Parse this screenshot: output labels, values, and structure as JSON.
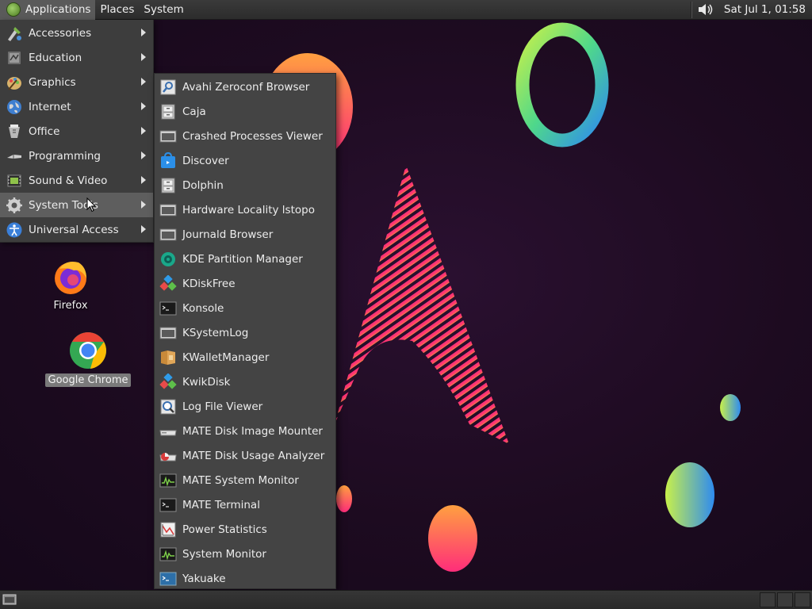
{
  "top_panel": {
    "menus": [
      "Applications",
      "Places",
      "System"
    ],
    "clock": "Sat Jul  1, 01:58"
  },
  "app_menu": {
    "items": [
      {
        "label": "Accessories",
        "icon": "accessories-icon"
      },
      {
        "label": "Education",
        "icon": "education-icon"
      },
      {
        "label": "Graphics",
        "icon": "graphics-icon"
      },
      {
        "label": "Internet",
        "icon": "internet-icon"
      },
      {
        "label": "Office",
        "icon": "office-icon"
      },
      {
        "label": "Programming",
        "icon": "programming-icon"
      },
      {
        "label": "Sound & Video",
        "icon": "sound-video-icon"
      },
      {
        "label": "System Tools",
        "icon": "system-tools-icon"
      },
      {
        "label": "Universal Access",
        "icon": "universal-access-icon"
      }
    ],
    "highlighted": "System Tools"
  },
  "system_tools": {
    "items": [
      {
        "label": "Avahi Zeroconf Browser",
        "icon": "magnifier-icon"
      },
      {
        "label": "Caja",
        "icon": "file-cabinet-icon"
      },
      {
        "label": "Crashed Processes Viewer",
        "icon": "window-icon"
      },
      {
        "label": "Discover",
        "icon": "store-bag-icon"
      },
      {
        "label": "Dolphin",
        "icon": "file-cabinet-icon"
      },
      {
        "label": "Hardware Locality lstopo",
        "icon": "window-icon"
      },
      {
        "label": "Journald Browser",
        "icon": "window-icon"
      },
      {
        "label": "KDE Partition Manager",
        "icon": "partition-icon"
      },
      {
        "label": "KDiskFree",
        "icon": "cubes-icon"
      },
      {
        "label": "Konsole",
        "icon": "terminal-icon"
      },
      {
        "label": "KSystemLog",
        "icon": "window-icon"
      },
      {
        "label": "KWalletManager",
        "icon": "wallet-icon"
      },
      {
        "label": "KwikDisk",
        "icon": "cubes-icon"
      },
      {
        "label": "Log File Viewer",
        "icon": "log-viewer-icon"
      },
      {
        "label": "MATE Disk Image Mounter",
        "icon": "disk-image-icon"
      },
      {
        "label": "MATE Disk Usage Analyzer",
        "icon": "disk-usage-icon"
      },
      {
        "label": "MATE System Monitor",
        "icon": "system-monitor-icon"
      },
      {
        "label": "MATE Terminal",
        "icon": "terminal-icon"
      },
      {
        "label": "Power Statistics",
        "icon": "power-statistics-icon"
      },
      {
        "label": "System Monitor",
        "icon": "system-monitor-icon"
      },
      {
        "label": "Yakuake",
        "icon": "yakuake-icon"
      }
    ]
  },
  "desktop": {
    "icons": [
      {
        "label": "Firefox",
        "icon": "firefox-icon"
      },
      {
        "label": "Google Chrome",
        "icon": "chrome-icon"
      }
    ]
  },
  "colors": {
    "panel": "#2c2c2c",
    "menu_bg": "#3d3d3d",
    "submenu_bg": "#444444",
    "hover": "#5e5e5e"
  }
}
